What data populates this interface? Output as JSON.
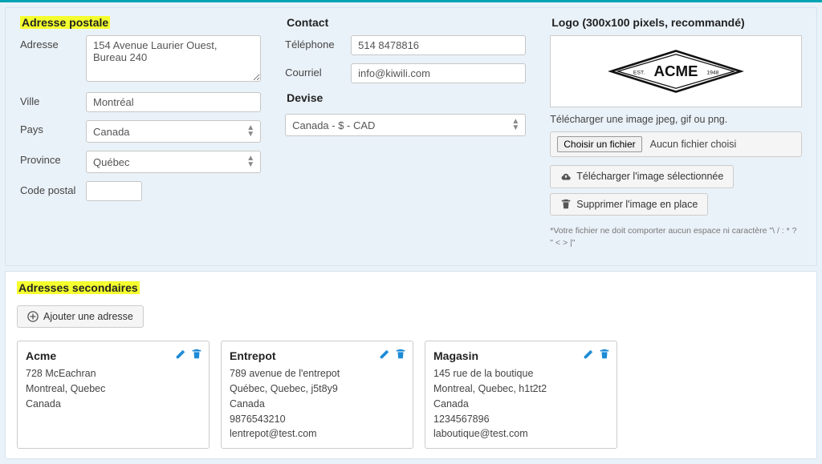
{
  "sections": {
    "postal": {
      "title": "Adresse postale",
      "address_label": "Adresse",
      "address_value": "154 Avenue Laurier Ouest,\nBureau 240",
      "city_label": "Ville",
      "city_value": "Montréal",
      "country_label": "Pays",
      "country_value": "Canada",
      "province_label": "Province",
      "province_value": "Québec",
      "zip_label": "Code postal",
      "zip_value": ""
    },
    "contact": {
      "title": "Contact",
      "phone_label": "Téléphone",
      "phone_value": "514 8478816",
      "email_label": "Courriel",
      "email_value": "info@kiwili.com"
    },
    "currency": {
      "title": "Devise",
      "value": "Canada - $ - CAD"
    },
    "logo": {
      "title": "Logo (300x100 pixels, recommandé)",
      "brand": "ACME",
      "est": "EST.",
      "year": "1948",
      "help": "Télécharger une image jpeg, gif ou png.",
      "choose_btn": "Choisir un fichier",
      "no_file": "Aucun fichier choisi",
      "upload_btn": "Télécharger l'image sélectionnée",
      "delete_btn": "Supprimer l'image en place",
      "footnote": "*Votre fichier ne doit comporter aucun espace ni caractère \"\\ / : * ? \" < > |\""
    }
  },
  "secondary": {
    "title": "Adresses secondaires",
    "add_btn": "Ajouter une adresse",
    "cards": [
      {
        "name": "Acme",
        "line1": "728 McEachran",
        "line2": "Montreal, Quebec",
        "line3": "Canada",
        "line4": "",
        "line5": ""
      },
      {
        "name": "Entrepot",
        "line1": "789 avenue de l'entrepot",
        "line2": "Québec, Quebec, j5t8y9",
        "line3": "Canada",
        "line4": "9876543210",
        "line5": "lentrepot@test.com"
      },
      {
        "name": "Magasin",
        "line1": "145 rue de la boutique",
        "line2": "Montreal, Quebec, h1t2t2",
        "line3": "Canada",
        "line4": "1234567896",
        "line5": "laboutique@test.com"
      }
    ]
  }
}
